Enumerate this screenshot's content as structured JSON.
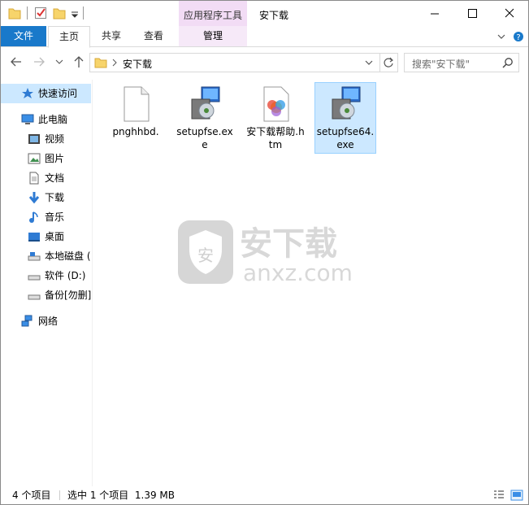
{
  "window": {
    "title": "安下载",
    "context_tab_group": "应用程序工具"
  },
  "ribbon": {
    "file_tab": "文件",
    "tabs": [
      "主页",
      "共享",
      "查看"
    ],
    "context_tab": "管理"
  },
  "address": {
    "path": "安下载",
    "search_placeholder": "搜索\"安下载\""
  },
  "sidebar": {
    "items": [
      {
        "label": "快速访问",
        "icon": "star-icon"
      },
      {
        "label": "此电脑",
        "icon": "computer-icon"
      },
      {
        "label": "视频",
        "icon": "video-icon"
      },
      {
        "label": "图片",
        "icon": "pictures-icon"
      },
      {
        "label": "文档",
        "icon": "documents-icon"
      },
      {
        "label": "下载",
        "icon": "download-icon"
      },
      {
        "label": "音乐",
        "icon": "music-icon"
      },
      {
        "label": "桌面",
        "icon": "desktop-icon"
      },
      {
        "label": "本地磁盘 (",
        "icon": "drive-icon"
      },
      {
        "label": "软件 (D:)",
        "icon": "drive-icon"
      },
      {
        "label": "备份[勿删]",
        "icon": "drive-icon"
      },
      {
        "label": "网络",
        "icon": "network-icon"
      }
    ]
  },
  "files": [
    {
      "name": "pnghhbd.",
      "icon": "blank-file-icon",
      "selected": false
    },
    {
      "name": "setupfse.exe",
      "icon": "installer-icon",
      "selected": false
    },
    {
      "name": "安下载帮助.htm",
      "icon": "web-page-icon",
      "selected": false
    },
    {
      "name": "setupfse64.exe",
      "icon": "installer-icon",
      "selected": true
    }
  ],
  "watermark": {
    "title": "安下载",
    "subtitle": "anxz.com",
    "shield_char": "安"
  },
  "status": {
    "item_count": "4 个项目",
    "selection": "选中 1 个项目  1.39 MB"
  },
  "colors": {
    "accent": "#1979ca",
    "selection": "#cce8ff",
    "context_tab": "#f2dcf5"
  }
}
